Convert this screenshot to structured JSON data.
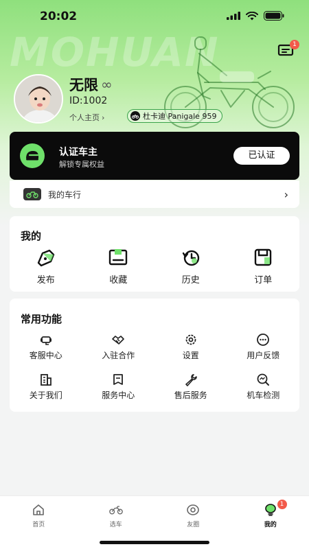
{
  "status_bar": {
    "time": "20:02"
  },
  "header": {
    "brand": "MOHUAN",
    "message_badge": "1",
    "user": {
      "name": "无限",
      "name_suffix": "∞",
      "id_text": "ID:1002",
      "homepage_link": "个人主页",
      "bike_tag": "杜卡迪 Panigale 959"
    }
  },
  "certification": {
    "title": "认证车主",
    "subtitle": "解锁专属权益",
    "button_label": "已认证"
  },
  "garage": {
    "label": "我的车行"
  },
  "mine": {
    "title": "我的",
    "items": [
      {
        "label": "发布",
        "icon": "publish-icon"
      },
      {
        "label": "收藏",
        "icon": "favorites-icon"
      },
      {
        "label": "历史",
        "icon": "history-icon"
      },
      {
        "label": "订单",
        "icon": "orders-icon"
      }
    ]
  },
  "functions": {
    "title": "常用功能",
    "items": [
      {
        "label": "客服中心",
        "icon": "customer-service-icon"
      },
      {
        "label": "入驻合作",
        "icon": "handshake-icon"
      },
      {
        "label": "设置",
        "icon": "gear-icon"
      },
      {
        "label": "用户反馈",
        "icon": "feedback-icon"
      },
      {
        "label": "关于我们",
        "icon": "building-icon"
      },
      {
        "label": "服务中心",
        "icon": "service-center-icon"
      },
      {
        "label": "售后服务",
        "icon": "wrench-icon"
      },
      {
        "label": "机车检测",
        "icon": "inspection-icon"
      }
    ]
  },
  "tabbar": {
    "tabs": [
      {
        "label": "首页",
        "icon": "home-icon"
      },
      {
        "label": "选车",
        "icon": "motorcycle-icon"
      },
      {
        "label": "友圈",
        "icon": "circle-icon"
      },
      {
        "label": "我的",
        "icon": "profile-icon",
        "active": true,
        "badge": "1"
      }
    ]
  },
  "colors": {
    "accent": "#6fe06a",
    "dark": "#0b0b0b",
    "badge": "#f25a4a"
  }
}
